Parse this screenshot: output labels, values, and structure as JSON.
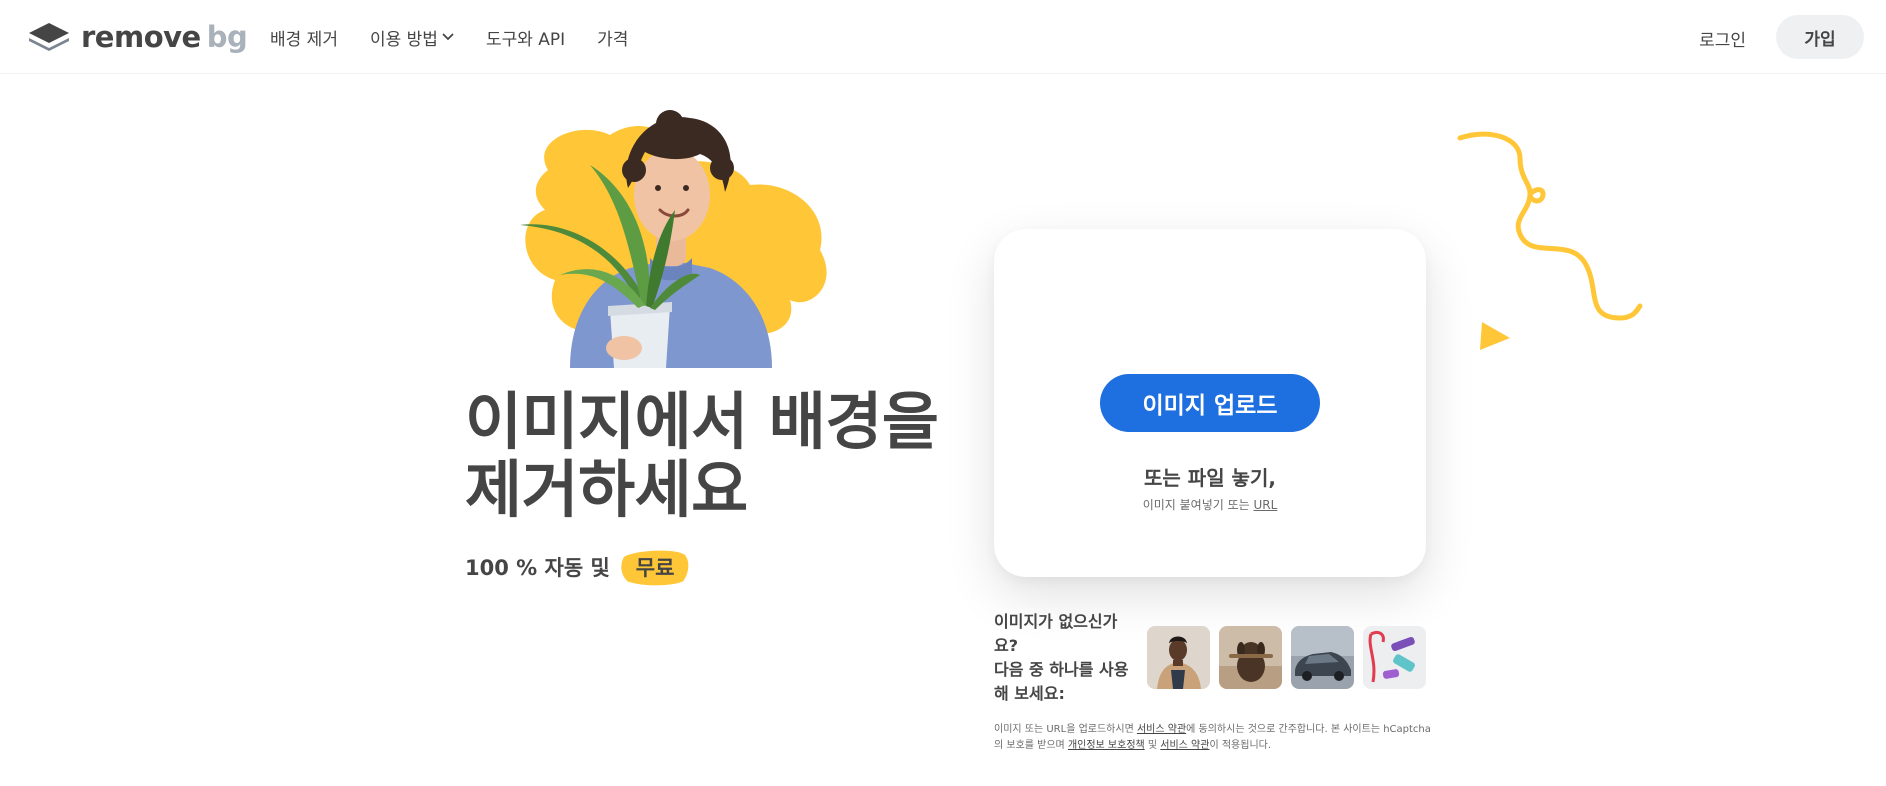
{
  "header": {
    "logo": {
      "word1": "remove",
      "word2": "bg"
    },
    "nav": [
      {
        "label": "배경 제거"
      },
      {
        "label": "이용 방법",
        "has_dropdown": true
      },
      {
        "label": "도구와 API"
      },
      {
        "label": "가격"
      }
    ],
    "login_label": "로그인",
    "signup_label": "가입"
  },
  "hero": {
    "headline_line1": "이미지에서 배경을",
    "headline_line2": "제거하세요",
    "subline_prefix": "100 % 자동 및",
    "subline_badge": "무료"
  },
  "upload": {
    "button_label": "이미지 업로드",
    "drop_text": "또는 파일 놓기,",
    "paste_prefix": "이미지 붙여넣기 또는 ",
    "paste_url": "URL"
  },
  "samples": {
    "prompt_line1": "이미지가 없으신가요?",
    "prompt_line2": "다음 중 하나를 사용해 보세요:",
    "items": [
      "woman-photo",
      "dog-photo",
      "car-photo",
      "fitness-gear-photo"
    ]
  },
  "terms": {
    "part1": "이미지 또는 URL을 업로드하시면 ",
    "link1": "서비스 약관",
    "part2": "에 동의하시는 것으로 간주합니다. 본 사이트는 hCaptcha의 보호를 받으며 ",
    "link2": "개인정보 보호정책",
    "part3": " 및 ",
    "link3": "서비스 약관",
    "part4": "이 적용됩니다."
  },
  "colors": {
    "accent_blue": "#1e6fe0",
    "accent_yellow": "#ffc737",
    "text_dark": "#454545",
    "logo_grey": "#a9b1bb"
  }
}
